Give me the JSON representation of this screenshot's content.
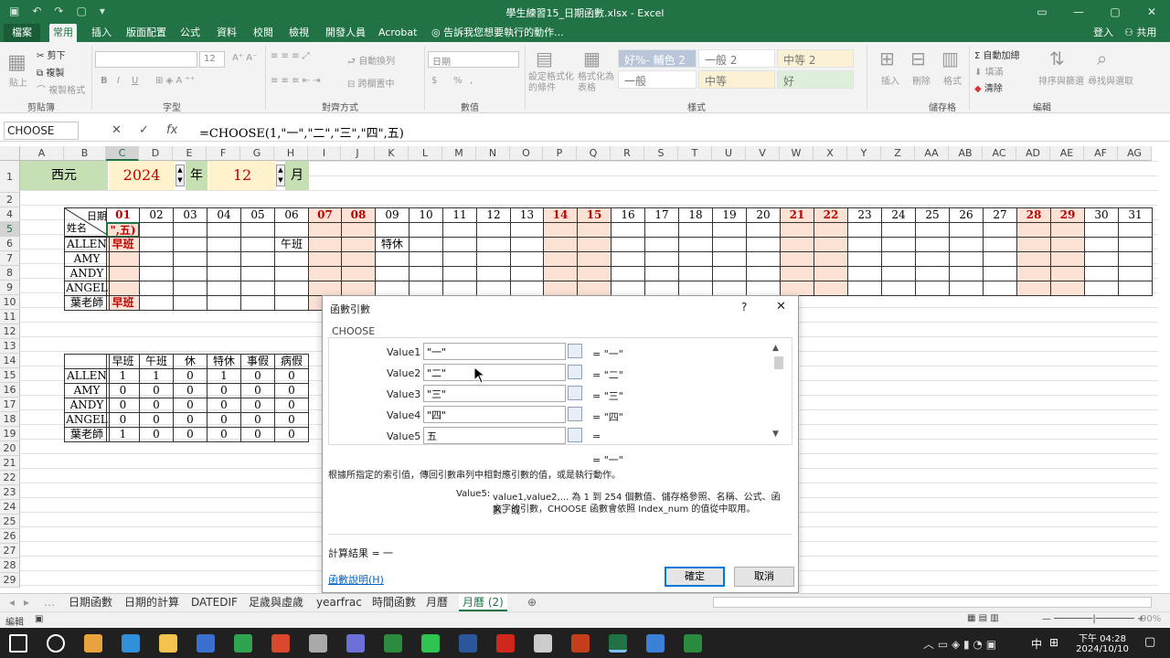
{
  "window": {
    "title": "學生練習15_日期函數.xlsx - Excel",
    "qat": [
      "▣",
      "↶",
      "↷",
      "▢",
      "▾"
    ],
    "controls": [
      "▭",
      "—",
      "▢",
      "✕"
    ]
  },
  "ribbon_tabs": [
    "檔案",
    "常用",
    "插入",
    "版面配置",
    "公式",
    "資料",
    "校閱",
    "檢視",
    "開發人員",
    "Acrobat"
  ],
  "tell_me": "告訴我您想要執行的動作...",
  "account": {
    "login": "登入",
    "share": "共用"
  },
  "ribbon": {
    "clipboard": {
      "paste": "貼上",
      "cut": "剪下",
      "copy": "複製",
      "painter": "複製格式",
      "label": "剪貼簿"
    },
    "font": {
      "label": "字型",
      "size": "12",
      "bold": "B",
      "italic": "I",
      "underline": "U"
    },
    "align": {
      "wrap": "自動換列",
      "merge": "跨欄置中",
      "label": "對齊方式"
    },
    "number": {
      "format": "日期",
      "currency": "$",
      "percent": "%",
      "comma": ",",
      "label": "數值"
    },
    "styles": {
      "cond": "設定格式化的條件",
      "table": "格式化為表格",
      "cells": [
        "好%- 輔色 2 2",
        "一般 2",
        "中等 2",
        "一般",
        "中等",
        "好"
      ],
      "label": "樣式"
    },
    "cells": {
      "insert": "插入",
      "delete": "刪除",
      "format": "格式",
      "label": "儲存格"
    },
    "edit": {
      "autosum": "自動加總",
      "fill": "填滿",
      "clear": "清除",
      "sort": "排序與篩選",
      "find": "尋找與選取",
      "label": "編輯"
    }
  },
  "namebox": "CHOOSE",
  "formula": "=CHOOSE(1,\"一\",\"二\",\"三\",\"四\",五)",
  "fx": {
    "cancel": "✕",
    "enter": "✓",
    "fx": "fx"
  },
  "columns": [
    "A",
    "B",
    "C",
    "D",
    "E",
    "F",
    "G",
    "H",
    "I",
    "J",
    "K",
    "L",
    "M",
    "N",
    "O",
    "P",
    "Q",
    "R",
    "S",
    "T",
    "U",
    "V",
    "W",
    "X",
    "Y",
    "Z",
    "AA",
    "AB",
    "AC",
    "AD",
    "AE",
    "AF",
    "AG"
  ],
  "rows": [
    "1",
    "2",
    "4",
    "5",
    "6",
    "7",
    "8",
    "9",
    "10",
    "11",
    "12",
    "13",
    "14",
    "15",
    "16",
    "17",
    "18",
    "19",
    "20",
    "21",
    "22",
    "23",
    "24",
    "25",
    "26",
    "27",
    "28",
    "29"
  ],
  "sheet": {
    "era": "西元",
    "year": "2024",
    "year_unit": "年",
    "month": "12",
    "month_unit": "月",
    "corner_date": "日期",
    "corner_name": "姓名",
    "days": [
      "01",
      "02",
      "03",
      "04",
      "05",
      "06",
      "07",
      "08",
      "09",
      "10",
      "11",
      "12",
      "13",
      "14",
      "15",
      "16",
      "17",
      "18",
      "19",
      "20",
      "21",
      "22",
      "23",
      "24",
      "25",
      "26",
      "27",
      "28",
      "29",
      "30",
      "31"
    ],
    "editing": "\",五)",
    "names": [
      "ALLEN",
      "AMY",
      "ANDY",
      "ANGEL",
      "葉老師"
    ],
    "shifts": {
      "allen_01": "早班",
      "allen_06": "午班",
      "allen_09": "特休",
      "teacher_01": "早班"
    },
    "summary_headers": [
      "早班",
      "午班",
      "休",
      "特休",
      "事假",
      "病假"
    ],
    "summary": [
      {
        "name": "ALLEN",
        "values": [
          "1",
          "1",
          "0",
          "1",
          "0",
          "0"
        ]
      },
      {
        "name": "AMY",
        "values": [
          "0",
          "0",
          "0",
          "0",
          "0",
          "0"
        ]
      },
      {
        "name": "ANDY",
        "values": [
          "0",
          "0",
          "0",
          "0",
          "0",
          "0"
        ]
      },
      {
        "name": "ANGEL",
        "values": [
          "0",
          "0",
          "0",
          "0",
          "0",
          "0"
        ]
      },
      {
        "name": "葉老師",
        "values": [
          "1",
          "0",
          "0",
          "0",
          "0",
          "0"
        ]
      }
    ]
  },
  "dialog": {
    "title": "函數引數",
    "help": "?",
    "close": "✕",
    "func": "CHOOSE",
    "args": [
      {
        "label": "Value1",
        "value": "\"一\"",
        "result": "= \"一\""
      },
      {
        "label": "Value2",
        "value": "\"二\"",
        "result": "= \"二\""
      },
      {
        "label": "Value3",
        "value": "\"三\"",
        "result": "= \"三\""
      },
      {
        "label": "Value4",
        "value": "\"四\"",
        "result": "= \"四\""
      },
      {
        "label": "Value5",
        "value": "五",
        "result": "="
      }
    ],
    "overall": "= \"一\"",
    "desc": "根據所指定的索引值，傳回引數串列中相對應引數的值，或是執行動作。",
    "param_name": "Value5:",
    "param_desc1": "value1,value2,... 為 1 到 254 個數值、儲存格參照、名稱、公式、函數、或",
    "param_desc2": "文字的引數，CHOOSE 函數會依照 Index_num 的值從中取用。",
    "result_label": "計算結果 =",
    "result_value": "一",
    "help_link": "函數說明(H)",
    "ok": "確定",
    "cancel": "取消"
  },
  "sheet_tabs": [
    "日期函數",
    "日期的計算",
    "DATEDIF",
    "足歲與虛歲",
    "yearfrac",
    "時間函數",
    "月曆",
    "月曆 (2)"
  ],
  "add_sheet": "⊕",
  "status": {
    "mode": "編輯",
    "zoom": "90%"
  },
  "taskbar": {
    "time": "下午 04:28",
    "date": "2024/10/10",
    "ime": "中",
    "icons": [
      "start-icon",
      "search-icon",
      "chrome-icon",
      "edge-icon",
      "explorer-icon",
      "store-icon",
      "app-icon",
      "red-app-icon",
      "cloud-icon",
      "discord-icon",
      "camtasia-icon",
      "line-icon",
      "word-icon",
      "acrobat-icon",
      "snip-icon",
      "powerpoint-icon",
      "excel-icon",
      "help-icon",
      "camtasia2-icon"
    ]
  }
}
